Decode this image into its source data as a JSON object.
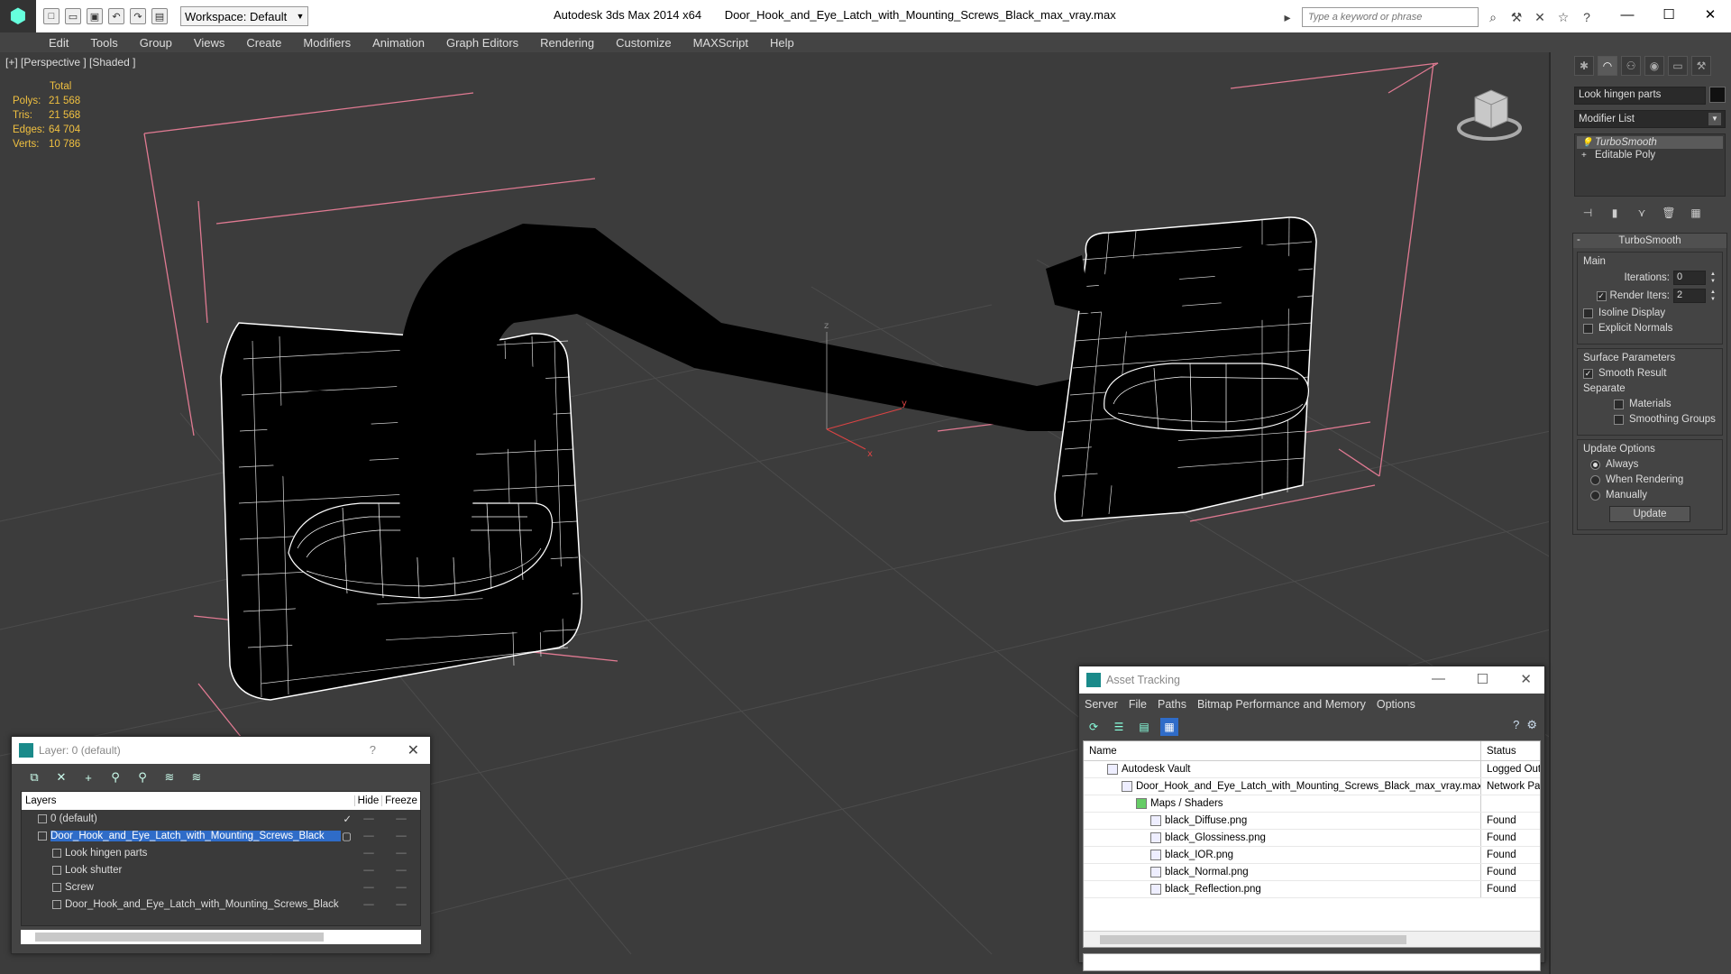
{
  "titlebar": {
    "workspace": "Workspace: Default",
    "app_title": "Autodesk 3ds Max  2014 x64",
    "file_name": "Door_Hook_and_Eye_Latch_with_Mounting_Screws_Black_max_vray.max",
    "search_placeholder": "Type a keyword or phrase"
  },
  "menu": [
    "Edit",
    "Tools",
    "Group",
    "Views",
    "Create",
    "Modifiers",
    "Animation",
    "Graph Editors",
    "Rendering",
    "Customize",
    "MAXScript",
    "Help"
  ],
  "viewport": {
    "label": "[+] [Perspective ] [Shaded ]",
    "stats": {
      "header": "Total",
      "rows": [
        {
          "k": "Polys:",
          "v": "21 568"
        },
        {
          "k": "Tris:",
          "v": "21 568"
        },
        {
          "k": "Edges:",
          "v": "64 704"
        },
        {
          "k": "Verts:",
          "v": "10 786"
        }
      ]
    }
  },
  "command_panel": {
    "object_name": "Look hingen parts",
    "modifier_list": "Modifier List",
    "stack": [
      "TurboSmooth",
      "Editable Poly"
    ],
    "rollout_title": "TurboSmooth",
    "main_group": "Main",
    "iterations_label": "Iterations:",
    "iterations_value": "0",
    "render_iters_label": "Render Iters:",
    "render_iters_value": "2",
    "isoline": "Isoline Display",
    "explicit_normals": "Explicit Normals",
    "surface_group": "Surface Parameters",
    "smooth_result": "Smooth Result",
    "separate": "Separate",
    "materials": "Materials",
    "smoothing_groups": "Smoothing Groups",
    "update_group": "Update Options",
    "always": "Always",
    "when_rendering": "When Rendering",
    "manually": "Manually",
    "update_button": "Update"
  },
  "layer_dialog": {
    "title": "Layer: 0 (default)",
    "help": "?",
    "columns": {
      "layers": "Layers",
      "hide": "Hide",
      "freeze": "Freeze"
    },
    "rows": [
      {
        "name": "0 (default)"
      },
      {
        "name": "Door_Hook_and_Eye_Latch_with_Mounting_Screws_Black"
      },
      {
        "name": "Look hingen parts"
      },
      {
        "name": "Look shutter"
      },
      {
        "name": "Screw"
      },
      {
        "name": "Door_Hook_and_Eye_Latch_with_Mounting_Screws_Black"
      }
    ]
  },
  "asset_dialog": {
    "title": "Asset Tracking",
    "menu": [
      "Server",
      "File",
      "Paths",
      "Bitmap Performance and Memory",
      "Options"
    ],
    "columns": {
      "name": "Name",
      "status": "Status"
    },
    "rows": [
      {
        "name": "Autodesk Vault",
        "status": "Logged Out"
      },
      {
        "name": "Door_Hook_and_Eye_Latch_with_Mounting_Screws_Black_max_vray.max",
        "status": "Network Path"
      },
      {
        "name": "Maps / Shaders",
        "status": ""
      },
      {
        "name": "black_Diffuse.png",
        "status": "Found"
      },
      {
        "name": "black_Glossiness.png",
        "status": "Found"
      },
      {
        "name": "black_IOR.png",
        "status": "Found"
      },
      {
        "name": "black_Normal.png",
        "status": "Found"
      },
      {
        "name": "black_Reflection.png",
        "status": "Found"
      }
    ]
  },
  "colors": {
    "selection": "#2f6cc8",
    "stats": "#f0c040",
    "bbox": "#e88aa0"
  }
}
